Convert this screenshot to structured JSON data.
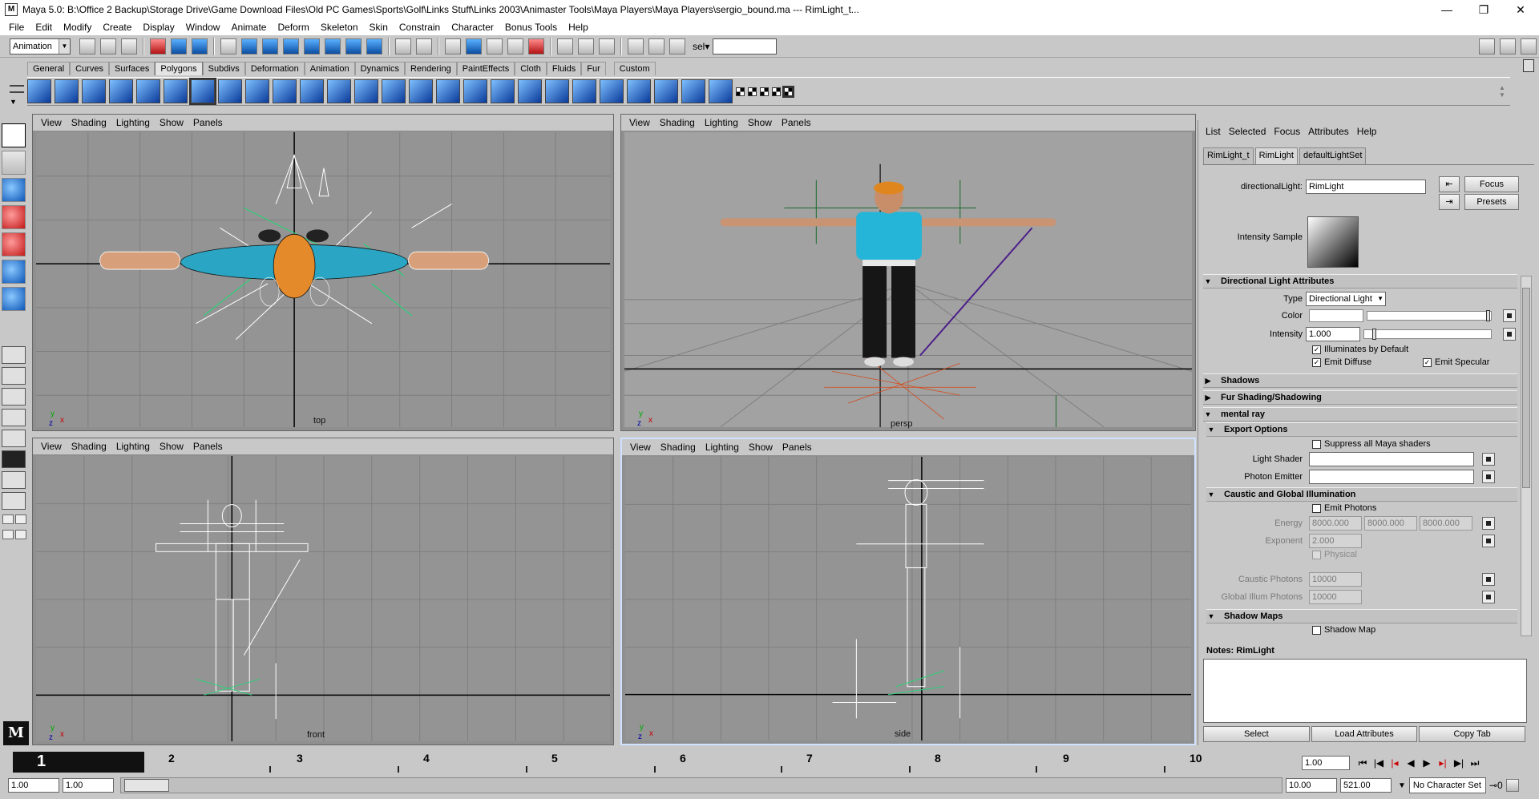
{
  "window": {
    "title": "Maya 5.0: B:\\Office 2 Backup\\Storage Drive\\Game Download Files\\Old PC Games\\Sports\\Golf\\Links Stuff\\Links 2003\\Animaster Tools\\Maya Players\\Maya Players\\sergio_bound.ma  ---  RimLight_t...",
    "minimize": "—",
    "restore": "❐",
    "close": "✕"
  },
  "menubar": [
    "File",
    "Edit",
    "Modify",
    "Create",
    "Display",
    "Window",
    "Animate",
    "Deform",
    "Skeleton",
    "Skin",
    "Constrain",
    "Character",
    "Bonus Tools",
    "Help"
  ],
  "statusline": {
    "mode": "Animation",
    "sel_label": "sel▾",
    "sel_value": ""
  },
  "shelf_tabs": [
    "General",
    "Curves",
    "Surfaces",
    "Polygons",
    "Subdivs",
    "Deformation",
    "Animation",
    "Dynamics",
    "Rendering",
    "PaintEffects",
    "Cloth",
    "Fluids",
    "Fur",
    "Custom"
  ],
  "shelf_active_tab": "Polygons",
  "viewport_menu": [
    "View",
    "Shading",
    "Lighting",
    "Show",
    "Panels"
  ],
  "viewports": {
    "top": {
      "label": "top"
    },
    "persp": {
      "label": "persp"
    },
    "front": {
      "label": "front"
    },
    "side": {
      "label": "side"
    }
  },
  "axis": {
    "x": "x",
    "y": "y",
    "z": "z"
  },
  "attribute_editor": {
    "menu": [
      "List",
      "Selected",
      "Focus",
      "Attributes",
      "Help"
    ],
    "tabs": [
      "RimLight_t",
      "RimLight",
      "defaultLightSet"
    ],
    "active_tab": "RimLight",
    "node_type_label": "directionalLight:",
    "node_name": "RimLight",
    "focus_btn": "Focus",
    "presets_btn": "Presets",
    "intensity_sample_label": "Intensity Sample",
    "sections": {
      "directional": "Directional Light Attributes",
      "shadows": "Shadows",
      "fur": "Fur Shading/Shadowing",
      "mental_ray": "mental ray",
      "export": "Export Options",
      "caustic": "Caustic and Global Illumination",
      "shadow_maps": "Shadow Maps"
    },
    "type_label": "Type",
    "type_value": "Directional Light",
    "color_label": "Color",
    "intensity_label": "Intensity",
    "intensity_value": "1.000",
    "illuminates_default": "Illuminates by Default",
    "emit_diffuse": "Emit Diffuse",
    "emit_specular": "Emit Specular",
    "suppress_shaders": "Suppress all Maya shaders",
    "light_shader_label": "Light Shader",
    "photon_emitter_label": "Photon Emitter",
    "emit_photons": "Emit Photons",
    "energy_label": "Energy",
    "energy_values": [
      "8000.000",
      "8000.000",
      "8000.000"
    ],
    "exponent_label": "Exponent",
    "exponent_value": "2.000",
    "physical": "Physical",
    "caustic_photons_label": "Caustic Photons",
    "caustic_photons_value": "10000",
    "global_illum_label": "Global Illum Photons",
    "global_illum_value": "10000",
    "shadow_map": "Shadow Map",
    "notes_label": "Notes: RimLight",
    "bottom_buttons": [
      "Select",
      "Load Attributes",
      "Copy Tab"
    ]
  },
  "timeline": {
    "current_frame": "1",
    "ticks": [
      "2",
      "3",
      "4",
      "5",
      "6",
      "7",
      "8",
      "9",
      "10"
    ],
    "current_time": "1.00"
  },
  "range": {
    "start": "1.00",
    "playback_start": "1.00",
    "playback_end": "10.00",
    "end": "521.00",
    "character_set": "No Character Set"
  }
}
